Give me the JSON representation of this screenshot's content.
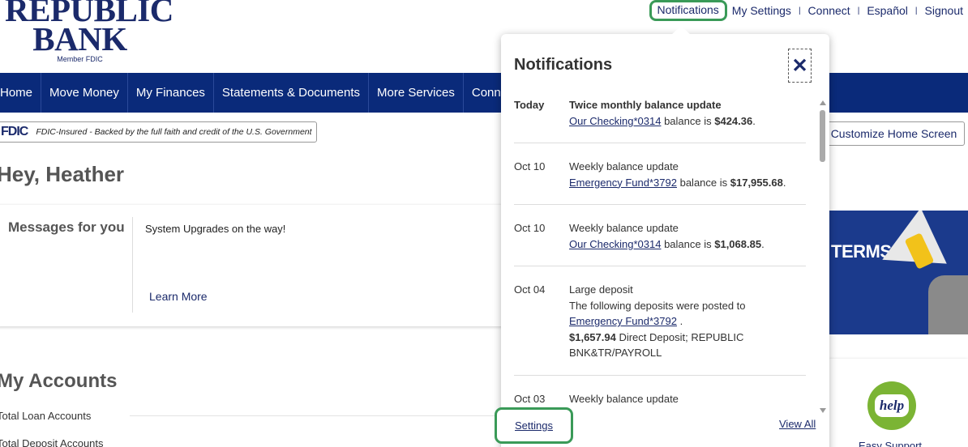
{
  "brand": {
    "line1": "REPUBLIC",
    "line2": "BANK",
    "member": "Member FDIC"
  },
  "toplinks": {
    "notifications": "Notifications",
    "my_settings": "My Settings",
    "connect": "Connect",
    "espanol": "Español",
    "signout": "Signout",
    "sep": "|"
  },
  "nav": {
    "items": [
      "Home",
      "Move Money",
      "My Finances",
      "Statements & Documents",
      "More Services",
      "Conn"
    ]
  },
  "fdic": {
    "mark": "FDIC",
    "text": "FDIC-Insured - Backed by the full faith and credit of the U.S. Government"
  },
  "customize_label": "Customize Home Screen",
  "greeting": "Hey, Heather",
  "messages": {
    "title": "Messages for you",
    "message": "System Upgrades on the way!",
    "learn_more": "Learn More"
  },
  "accounts": {
    "title": "My Accounts",
    "loan": "Total Loan Accounts",
    "deposit": "Total Deposit Accounts"
  },
  "banner": {
    "text": "TERMS"
  },
  "help": {
    "bubble": "help",
    "label": "Easy Support"
  },
  "notifications": {
    "title": "Notifications",
    "close": "✕",
    "items": [
      {
        "date": "Today",
        "heading": "Twice monthly balance update",
        "account": "Our Checking*0314",
        "mid": " balance is ",
        "amount": "$424.36",
        "end": "."
      },
      {
        "date": "Oct 10",
        "heading": "Weekly balance update",
        "account": "Emergency Fund*3792",
        "mid": " balance is ",
        "amount": "$17,955.68",
        "end": "."
      },
      {
        "date": "Oct 10",
        "heading": "Weekly balance update",
        "account": "Our Checking*0314",
        "mid": " balance is ",
        "amount": "$1,068.85",
        "end": "."
      },
      {
        "date": "Oct 04",
        "heading": "Large deposit",
        "intro": "The following deposits were posted to",
        "account": "Emergency Fund*3792",
        "after": " .",
        "amount": "$1,657.94",
        "desc": " Direct Deposit; REPUBLIC BNK&TR/PAYROLL"
      },
      {
        "date": "Oct 03",
        "heading": "Weekly balance update"
      }
    ],
    "settings": "Settings",
    "view_all": "View All"
  },
  "colors": {
    "nav": "#0a2a7a",
    "brand": "#1b2a6b",
    "highlight": "#3a9a58"
  }
}
